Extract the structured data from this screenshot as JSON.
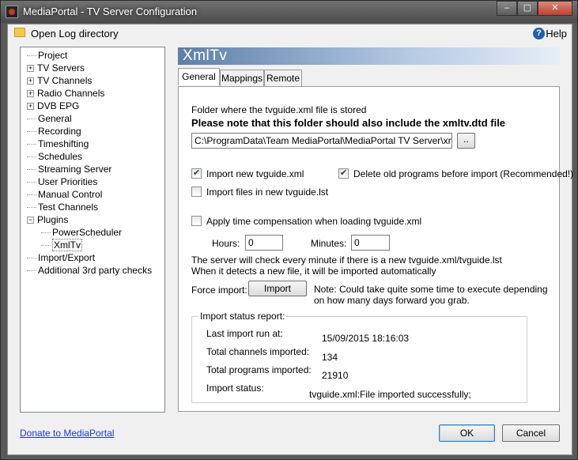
{
  "window": {
    "title": "MediaPortal - TV Server Configuration"
  },
  "toolbar": {
    "open_log": "Open Log directory",
    "help": "Help"
  },
  "tree": [
    {
      "label": "Project",
      "expander": "",
      "indent": 0
    },
    {
      "label": "TV Servers",
      "expander": "+",
      "indent": 0
    },
    {
      "label": "TV Channels",
      "expander": "+",
      "indent": 0
    },
    {
      "label": "Radio Channels",
      "expander": "+",
      "indent": 0
    },
    {
      "label": "DVB EPG",
      "expander": "+",
      "indent": 0
    },
    {
      "label": "General",
      "expander": "",
      "indent": 0
    },
    {
      "label": "Recording",
      "expander": "",
      "indent": 0
    },
    {
      "label": "Timeshifting",
      "expander": "",
      "indent": 0
    },
    {
      "label": "Schedules",
      "expander": "",
      "indent": 0
    },
    {
      "label": "Streaming Server",
      "expander": "",
      "indent": 0
    },
    {
      "label": "User Priorities",
      "expander": "",
      "indent": 0
    },
    {
      "label": "Manual Control",
      "expander": "",
      "indent": 0
    },
    {
      "label": "Test Channels",
      "expander": "",
      "indent": 0
    },
    {
      "label": "Plugins",
      "expander": "−",
      "indent": 0
    },
    {
      "label": "PowerScheduler",
      "expander": "",
      "indent": 1
    },
    {
      "label": "XmlTv",
      "expander": "",
      "indent": 1,
      "selected": true
    },
    {
      "label": "Import/Export",
      "expander": "",
      "indent": 0
    },
    {
      "label": "Additional 3rd party checks",
      "expander": "",
      "indent": 0
    }
  ],
  "header": {
    "title": "XmlTv"
  },
  "tabs": [
    {
      "label": "General"
    },
    {
      "label": "Mappings"
    },
    {
      "label": "Remote"
    }
  ],
  "general": {
    "folder_label": "Folder where the tvguide.xml file is stored",
    "note_bold": "Please note that this folder should also include the xmltv.dtd file",
    "folder_value": "C:\\ProgramData\\Team MediaPortal\\MediaPortal TV Server\\xmltv",
    "browse_label": "..",
    "import_new_label": "Import new tvguide.xml",
    "import_new_checked": true,
    "delete_old_label": "Delete old programs before import (Recommended!)",
    "delete_old_checked": true,
    "import_lst_label": "Import files in new tvguide.lst",
    "import_lst_checked": false,
    "time_comp_label": "Apply time compensation when loading tvguide.xml",
    "time_comp_checked": false,
    "hours_label": "Hours:",
    "hours_value": "0",
    "minutes_label": "Minutes:",
    "minutes_value": "0",
    "server_check_1": "The server will check every minute if there is a new tvguide.xml/tvguide.lst",
    "server_check_2": "When it detects a new file, it will be imported automatically",
    "force_label": "Force import:",
    "import_button": "Import",
    "force_note_1": "Note: Could take quite some time to execute depending",
    "force_note_2": "on how many days forward you grab."
  },
  "status": {
    "title": "Import status report:",
    "last_run_label": "Last import run at:",
    "last_run_value": "15/09/2015 18:16:03",
    "channels_label": "Total channels imported:",
    "channels_value": "134",
    "programs_label": "Total programs imported:",
    "programs_value": "21910",
    "status_label": "Import status:",
    "status_value": "tvguide.xml:File imported successfully;"
  },
  "footer": {
    "donate": "Donate to MediaPortal",
    "ok": "OK",
    "cancel": "Cancel"
  }
}
